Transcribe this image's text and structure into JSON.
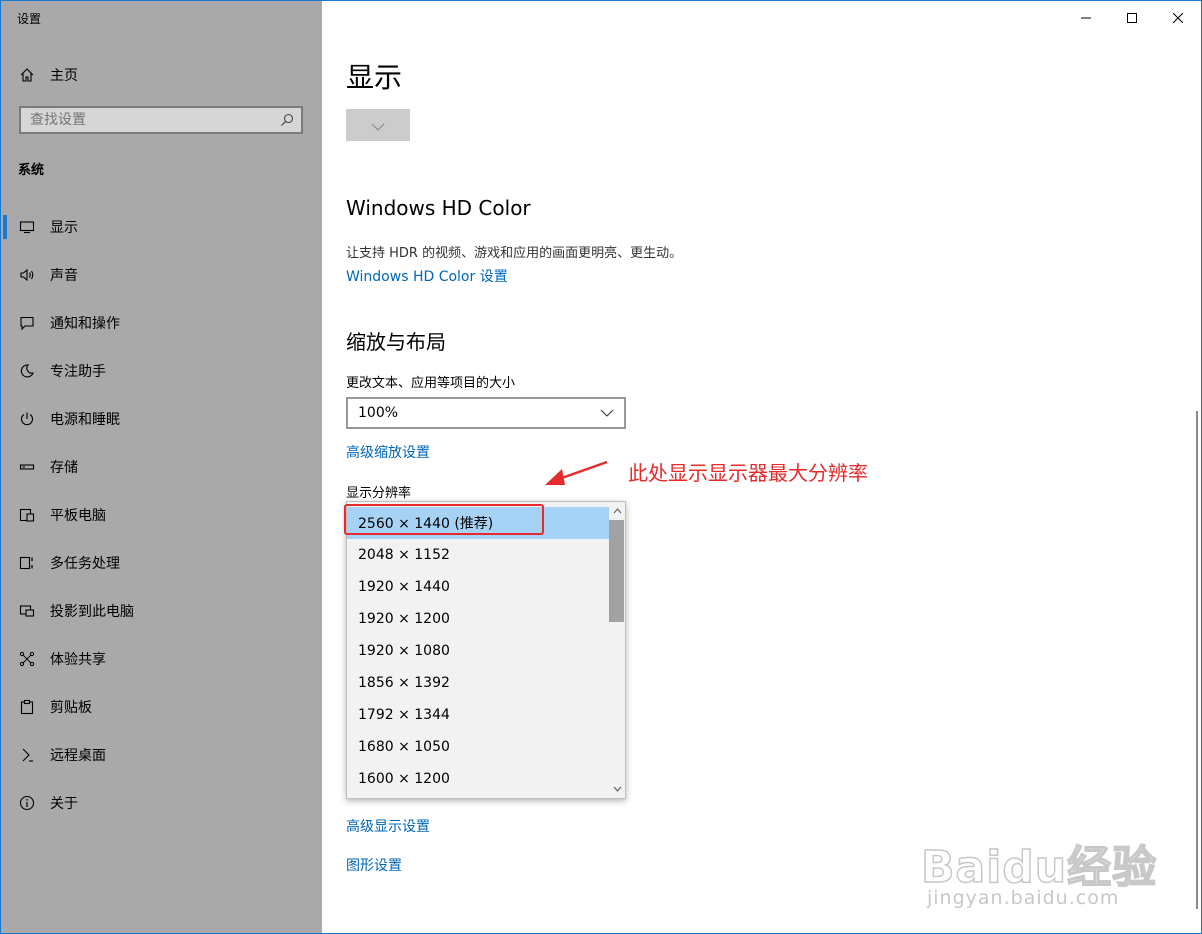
{
  "window": {
    "title": "设置"
  },
  "sidebar": {
    "home": "主页",
    "search_placeholder": "查找设置",
    "section": "系统",
    "items": [
      {
        "label": "显示",
        "icon": "monitor-icon",
        "active": true
      },
      {
        "label": "声音",
        "icon": "speaker-icon"
      },
      {
        "label": "通知和操作",
        "icon": "message-icon"
      },
      {
        "label": "专注助手",
        "icon": "moon-icon"
      },
      {
        "label": "电源和睡眠",
        "icon": "power-icon"
      },
      {
        "label": "存储",
        "icon": "storage-icon"
      },
      {
        "label": "平板电脑",
        "icon": "tablet-icon"
      },
      {
        "label": "多任务处理",
        "icon": "multitask-icon"
      },
      {
        "label": "投影到此电脑",
        "icon": "project-icon"
      },
      {
        "label": "体验共享",
        "icon": "share-icon"
      },
      {
        "label": "剪贴板",
        "icon": "clipboard-icon"
      },
      {
        "label": "远程桌面",
        "icon": "remote-icon"
      },
      {
        "label": "关于",
        "icon": "info-icon"
      }
    ]
  },
  "main": {
    "title": "显示",
    "hd_color": {
      "heading": "Windows HD Color",
      "desc": "让支持 HDR 的视频、游戏和应用的画面更明亮、更生动。",
      "link": "Windows HD Color 设置"
    },
    "scale": {
      "heading": "缩放与布局",
      "text_size_label": "更改文本、应用等项目的大小",
      "text_size_value": "100%",
      "advanced_link": "高级缩放设置",
      "resolution_label": "显示分辨率"
    },
    "resolutions": [
      "2560 × 1440 (推荐)",
      "2048 × 1152",
      "1920 × 1440",
      "1920 × 1200",
      "1920 × 1080",
      "1856 × 1392",
      "1792 × 1344",
      "1680 × 1050",
      "1600 × 1200"
    ],
    "selected_resolution": 0,
    "advanced_display_link": "高级显示设置",
    "graphics_link": "图形设置"
  },
  "annotation": {
    "text": "此处显示显示器最大分辨率",
    "color": "#e52b2b"
  },
  "watermark": {
    "main": "Baidu经验",
    "sub": "jingyan.baidu.com"
  },
  "colors": {
    "accent": "#1979ca",
    "link": "#0067b8",
    "sidebar_bg": "#a9a9a9",
    "selected_item": "#a6d2f5"
  }
}
